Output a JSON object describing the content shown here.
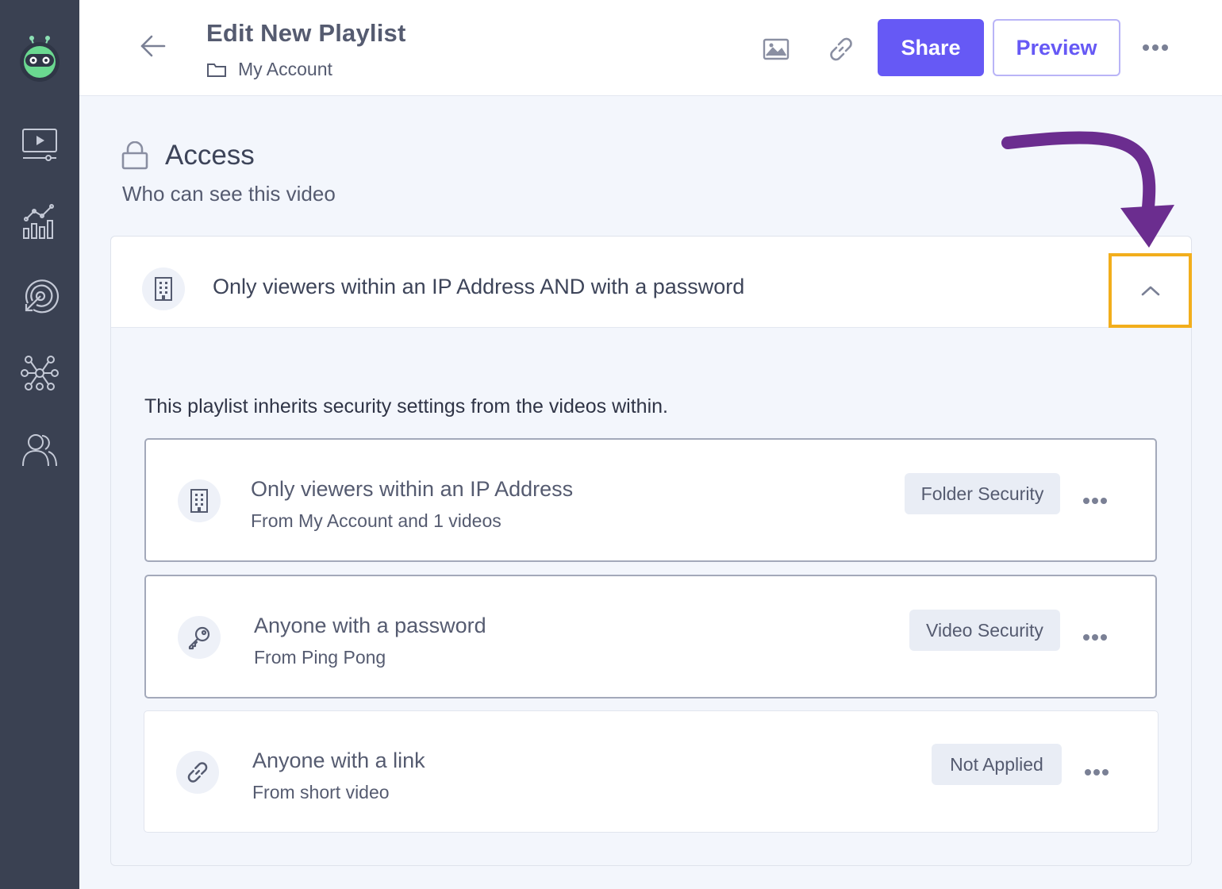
{
  "sidebar": {
    "logo": "robot-logo",
    "items": [
      {
        "icon": "video-library-icon"
      },
      {
        "icon": "analytics-icon"
      },
      {
        "icon": "target-icon"
      },
      {
        "icon": "integrations-icon"
      },
      {
        "icon": "users-icon"
      }
    ]
  },
  "header": {
    "title": "Edit New Playlist",
    "breadcrumb": "My Account",
    "share_label": "Share",
    "preview_label": "Preview"
  },
  "access": {
    "title": "Access",
    "subtitle": "Who can see this video",
    "selected": "Only viewers within an IP Address AND with a password",
    "inherit_note": "This playlist inherits security settings from the videos within.",
    "rules": [
      {
        "title": "Only viewers within an IP Address",
        "source": "From My Account and 1 videos",
        "tag": "Folder Security",
        "icon": "building-icon"
      },
      {
        "title": "Anyone with a password",
        "source": "From Ping Pong",
        "tag": "Video Security",
        "icon": "key-icon"
      },
      {
        "title": "Anyone with a link",
        "source": "From short video",
        "tag": "Not Applied",
        "icon": "link-icon"
      }
    ]
  },
  "colors": {
    "sidebar": "#3a4152",
    "accent": "#6659f5",
    "highlight": "#f2ae1c",
    "arrow": "#6b2d8f"
  }
}
